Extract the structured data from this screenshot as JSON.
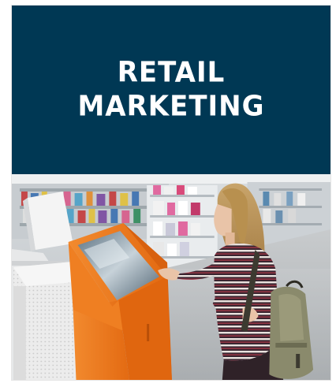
{
  "banner": {
    "title_line1": "RETAIL",
    "title_line2": "MARKETING",
    "background_color": "#003854",
    "text_color": "#ffffff"
  },
  "photo": {
    "description_icon": "retail-kiosk-photo",
    "kiosk_color": "#f07a1f"
  }
}
